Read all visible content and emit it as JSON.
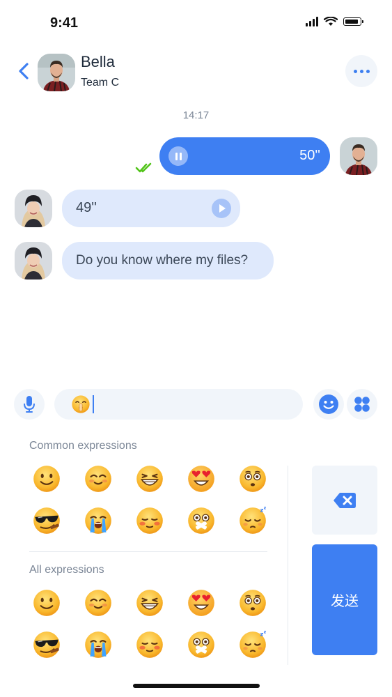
{
  "status_bar": {
    "time": "9:41"
  },
  "header": {
    "contact_name": "Bella",
    "contact_team": "Team C"
  },
  "conversation": {
    "timestamp": "14:17",
    "outgoing_voice": {
      "duration": "50''",
      "status": "read"
    },
    "incoming_voice": {
      "duration": "49''"
    },
    "incoming_text": {
      "text": "Do you know where my files?"
    }
  },
  "composer": {
    "current_value_emoji": "shushing-face",
    "placeholder": ""
  },
  "emoji_panel": {
    "common_title": "Common expressions",
    "all_title": "All expressions",
    "common": [
      "smiling-face",
      "blushing-face",
      "grinning-squint",
      "heart-eyes",
      "flushed-face",
      "sunglasses-cool",
      "crying-face",
      "shy-face",
      "mouth-taped",
      "sleeping-face"
    ],
    "all": [
      "smiling-face",
      "blushing-face",
      "grinning-squint",
      "heart-eyes",
      "flushed-face",
      "sunglasses-cool",
      "crying-face",
      "shy-face",
      "mouth-taped",
      "sleeping-face"
    ],
    "send_label": "发送"
  },
  "colors": {
    "accent": "#3e7ff2",
    "incoming_bubble": "#dfe9fc",
    "check": "#52c41a",
    "emoji_face": "#f9b72c"
  }
}
